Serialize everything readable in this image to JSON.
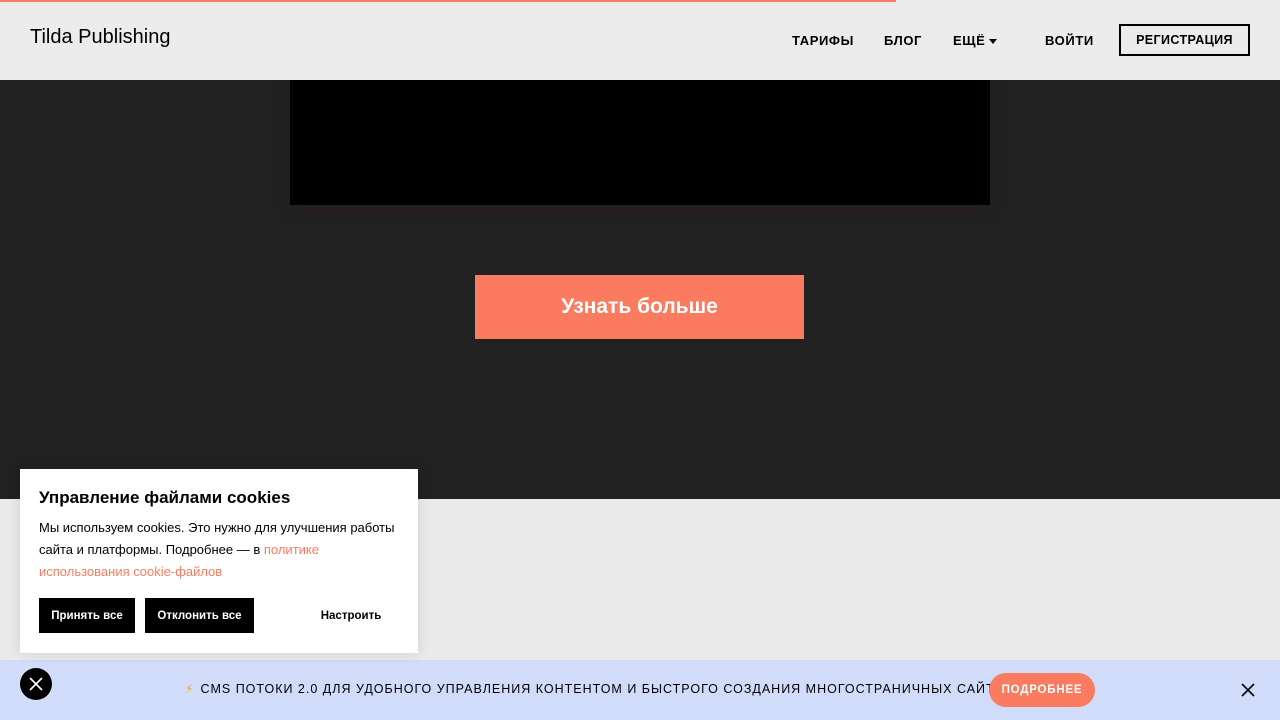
{
  "header": {
    "logo": "Tilda Publishing",
    "nav": {
      "tariffs": "ТАРИФЫ",
      "blog": "БЛОГ",
      "more": "ЕЩЁ",
      "login": "ВОЙТИ"
    },
    "register_label": "РЕГИСТРАЦИЯ"
  },
  "hero": {
    "cta_label": "Узнать больше"
  },
  "cookie_panel": {
    "title": "Управление файлами cookies",
    "text": "Мы используем cookies. Это нужно для улучшения работы сайта и платформы. Подробнее — в ",
    "link_text": "политике использования cookie-файлов",
    "accept_label": "Принять все",
    "decline_label": "Отклонить все",
    "settings_label": "Настроить"
  },
  "promo_bar": {
    "text": "CMS ПОТОКИ 2.0 ДЛЯ УДОБНОГО УПРАВЛЕНИЯ КОНТЕНТОМ И БЫСТРОГО СОЗДАНИЯ МНОГОСТРАНИЧНЫХ САЙТОВ",
    "icon": "lightning-icon",
    "button_label": "ПОДРОБНЕЕ"
  },
  "colors": {
    "accent": "#fa7b5f",
    "dark_section": "#212121",
    "promo_bar": "#d1dcfa"
  }
}
